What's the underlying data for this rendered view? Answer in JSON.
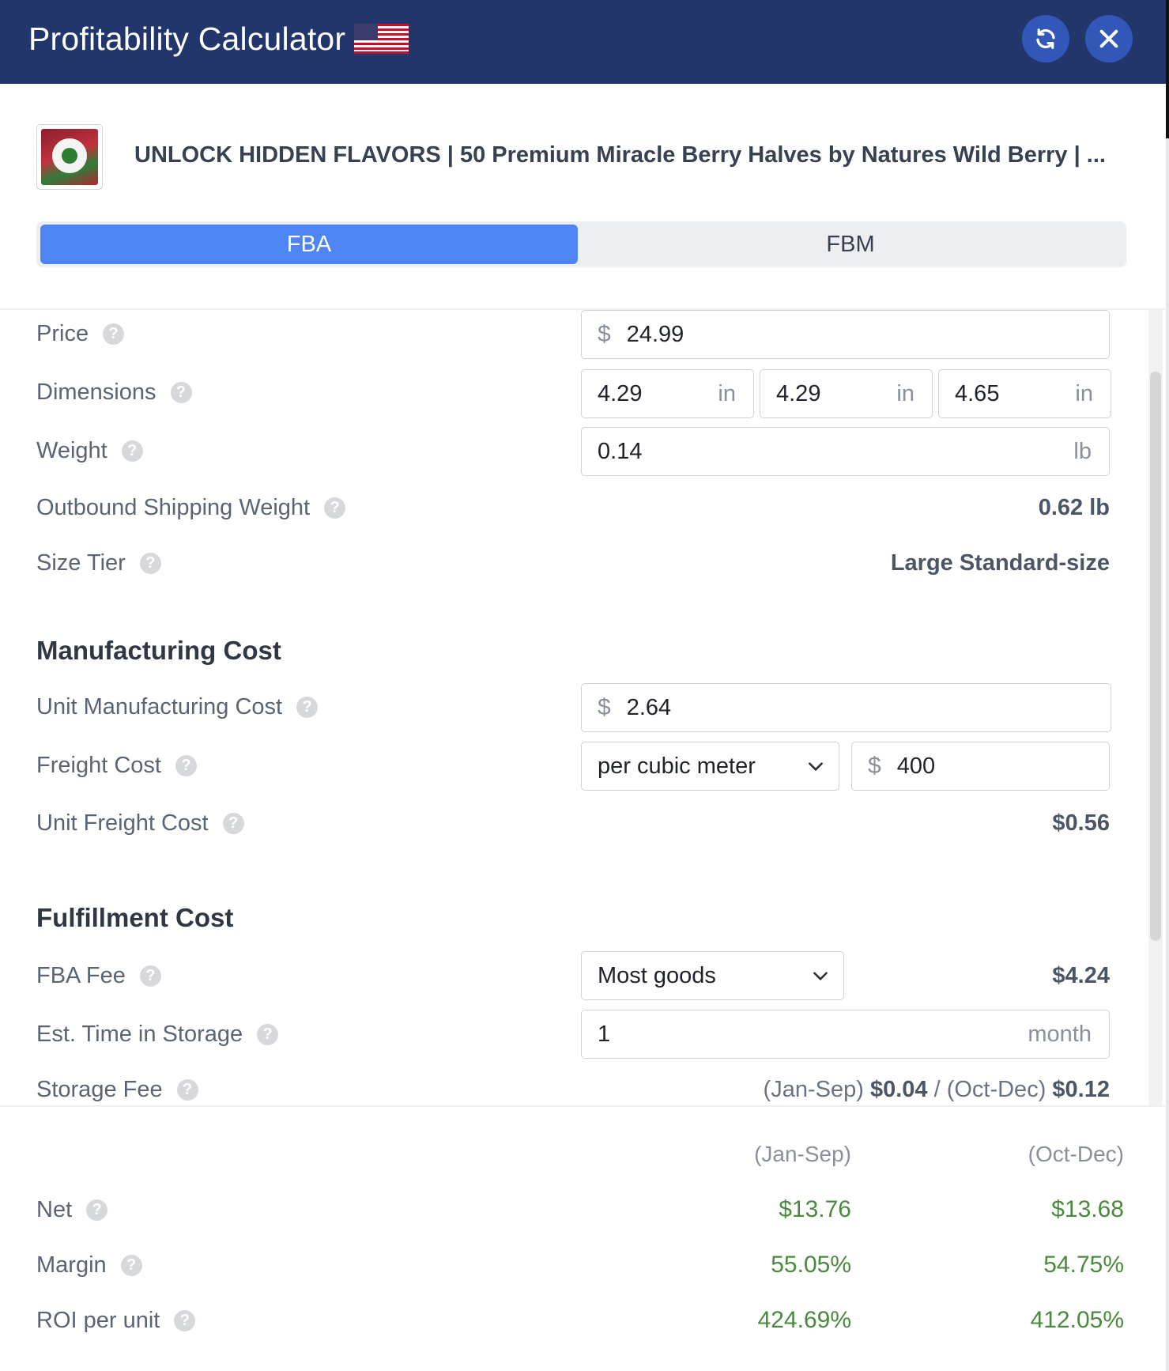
{
  "header": {
    "title": "Profitability Calculator",
    "flag_icon": "us-flag-icon",
    "bg_color": "#22366b"
  },
  "product": {
    "title": "UNLOCK HIDDEN FLAVORS | 50 Premium Miracle Berry Halves by Natures Wild Berry | ..."
  },
  "tabs": [
    {
      "label": "FBA",
      "active": true
    },
    {
      "label": "FBM",
      "active": false
    }
  ],
  "fields": {
    "price": {
      "label": "Price",
      "currency": "$",
      "value": "24.99"
    },
    "dimensions": {
      "label": "Dimensions",
      "values": [
        "4.29",
        "4.29",
        "4.65"
      ],
      "unit": "in"
    },
    "weight": {
      "label": "Weight",
      "value": "0.14",
      "unit": "lb"
    },
    "outbound": {
      "label": "Outbound Shipping Weight",
      "value": "0.62 lb"
    },
    "size_tier": {
      "label": "Size Tier",
      "value": "Large Standard-size"
    }
  },
  "manufacturing": {
    "title": "Manufacturing Cost",
    "unit_cost": {
      "label": "Unit Manufacturing Cost",
      "currency": "$",
      "value": "2.64"
    },
    "freight": {
      "label": "Freight Cost",
      "selected": "per cubic meter",
      "currency": "$",
      "value": "400"
    },
    "unit_freight": {
      "label": "Unit Freight Cost",
      "value": "$0.56"
    }
  },
  "fulfillment": {
    "title": "Fulfillment Cost",
    "fba_fee": {
      "label": "FBA Fee",
      "selected": "Most goods",
      "value": "$4.24"
    },
    "storage_time": {
      "label": "Est. Time in Storage",
      "value": "1",
      "unit": "month"
    },
    "storage_fee": {
      "label": "Storage Fee",
      "period1": "(Jan-Sep)",
      "value1": "$0.04",
      "sep": " / ",
      "period2": "(Oct-Dec)",
      "value2": "$0.12"
    }
  },
  "results": {
    "col1": "(Jan-Sep)",
    "col2": "(Oct-Dec)",
    "net": {
      "label": "Net",
      "v1": "$13.76",
      "v2": "$13.68"
    },
    "margin": {
      "label": "Margin",
      "v1": "55.05%",
      "v2": "54.75%"
    },
    "roi": {
      "label": "ROI per unit",
      "v1": "424.69%",
      "v2": "412.05%"
    }
  },
  "colors": {
    "accent": "#4f85f2",
    "positive": "#4a8a3d"
  }
}
